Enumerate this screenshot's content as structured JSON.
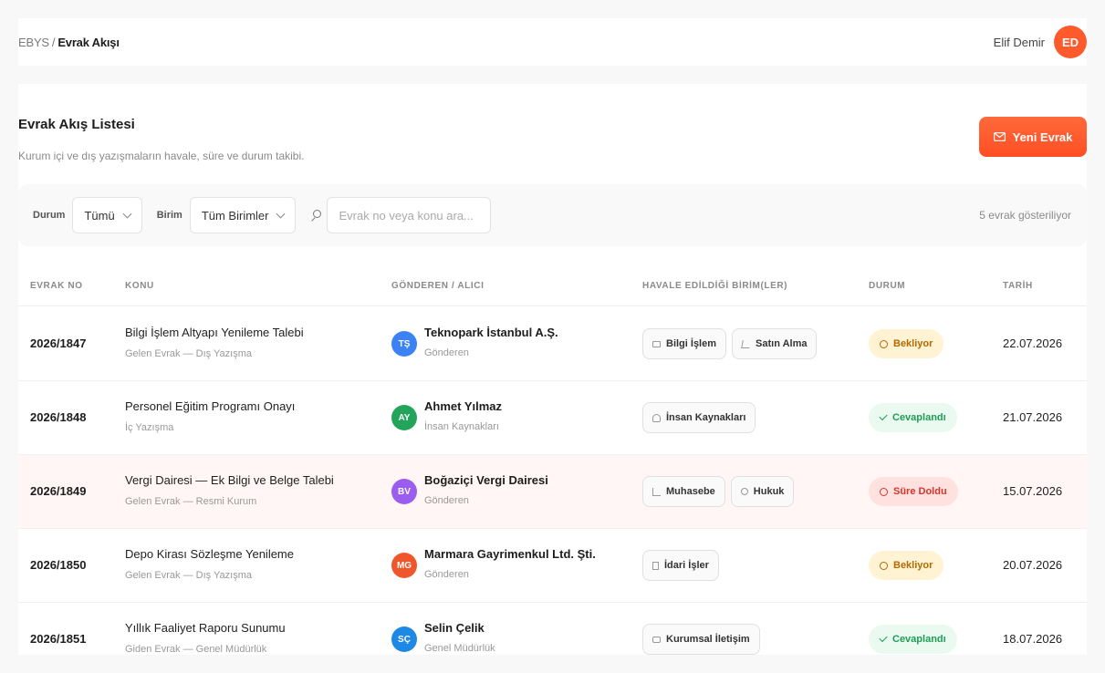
{
  "breadcrumb": {
    "root": "EBYS",
    "separator": "/",
    "current": "Evrak Akışı"
  },
  "user": {
    "name": "Elif Demir",
    "initials": "ED",
    "avatar_color": "#ff5a2c"
  },
  "page": {
    "title": "Evrak Akış Listesi",
    "subtitle": "Kurum içi ve dış yazışmaların havale, süre ve durum takibi.",
    "new_button_label": "Yeni Evrak",
    "new_button_icon": "mail-icon"
  },
  "filters": {
    "status_label": "Durum",
    "status_value": "Tümü",
    "unit_label": "Birim",
    "unit_value": "Tüm Birimler",
    "search_placeholder": "Evrak no veya konu ara...",
    "count_text": "5 evrak gösteriliyor"
  },
  "table": {
    "columns": [
      "EVRAK NO",
      "KONU",
      "GÖNDEREN / ALICI",
      "HAVALE EDİLDİĞİ BİRİM(LER)",
      "DURUM",
      "TARİH"
    ],
    "rows": [
      {
        "no": "2026/1847",
        "subject": "Bilgi İşlem Altyapı Yenileme Talebi",
        "type": "Gelen Evrak — Dış Yazışma",
        "party_initials": "TŞ",
        "party_color": "#3b82f6",
        "party_name": "Teknopark İstanbul A.Ş.",
        "party_role": "Gönderen",
        "units": [
          {
            "label": "Bilgi İşlem",
            "icon": "monitor-icon"
          },
          {
            "label": "Satın Alma",
            "icon": "cart-icon"
          }
        ],
        "status": "Bekliyor",
        "status_kind": "pending",
        "date": "22.07.2026"
      },
      {
        "no": "2026/1848",
        "subject": "Personel Eğitim Programı Onayı",
        "type": "İç Yazışma",
        "party_initials": "AY",
        "party_color": "#22a55a",
        "party_name": "Ahmet Yılmaz",
        "party_role": "İnsan Kaynakları",
        "units": [
          {
            "label": "İnsan Kaynakları",
            "icon": "people-icon"
          }
        ],
        "status": "Cevaplandı",
        "status_kind": "answered",
        "date": "21.07.2026"
      },
      {
        "no": "2026/1849",
        "subject": "Vergi Dairesi — Ek Bilgi ve Belge Talebi",
        "type": "Gelen Evrak — Resmi Kurum",
        "party_initials": "BV",
        "party_color": "#9b5cf0",
        "party_name": "Boğaziçi Vergi Dairesi",
        "party_role": "Gönderen",
        "units": [
          {
            "label": "Muhasebe",
            "icon": "chart-icon"
          },
          {
            "label": "Hukuk",
            "icon": "scale-icon"
          }
        ],
        "status": "Süre Doldu",
        "status_kind": "expired",
        "date": "15.07.2026"
      },
      {
        "no": "2026/1850",
        "subject": "Depo Kirası Sözleşme Yenileme",
        "type": "Gelen Evrak — Dış Yazışma",
        "party_initials": "MG",
        "party_color": "#f0562c",
        "party_name": "Marmara Gayrimenkul Ltd. Şti.",
        "party_role": "Gönderen",
        "units": [
          {
            "label": "İdari İşler",
            "icon": "building-icon"
          }
        ],
        "status": "Bekliyor",
        "status_kind": "pending",
        "date": "20.07.2026"
      },
      {
        "no": "2026/1851",
        "subject": "Yıllık Faaliyet Raporu Sunumu",
        "type": "Giden Evrak — Genel Müdürlük",
        "party_initials": "SÇ",
        "party_color": "#1e88e5",
        "party_name": "Selin Çelik",
        "party_role": "Genel Müdürlük",
        "units": [
          {
            "label": "Kurumsal İletişim",
            "icon": "message-icon"
          }
        ],
        "status": "Cevaplandı",
        "status_kind": "answered",
        "date": "18.07.2026"
      }
    ]
  }
}
